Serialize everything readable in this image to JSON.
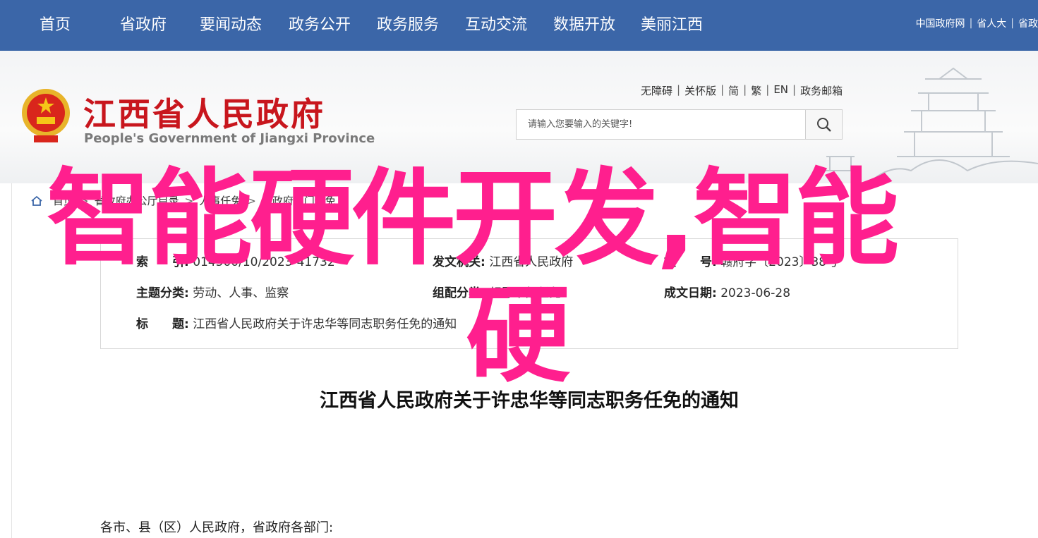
{
  "nav": {
    "items": [
      {
        "label": "首页"
      },
      {
        "label": "省政府"
      },
      {
        "label": "要闻动态"
      },
      {
        "label": "政务公开"
      },
      {
        "label": "政务服务"
      },
      {
        "label": "互动交流"
      },
      {
        "label": "数据开放"
      },
      {
        "label": "美丽江西"
      }
    ],
    "top_links": [
      "中国政府网",
      "省人大",
      "省政"
    ]
  },
  "header": {
    "title_cn": "江西省人民政府",
    "title_en": "People's Government of Jiangxi Province",
    "util_links": [
      "无障碍",
      "关怀版",
      "简",
      "繁",
      "EN",
      "政务邮箱"
    ],
    "search_placeholder": "请输入您要输入的关键字!"
  },
  "breadcrumb": [
    "首页",
    "省政府办公厅目录",
    "人事任免",
    "省政府部门任免"
  ],
  "meta": {
    "index_label": "索　　引",
    "index_value": "014500/10/2023-41732",
    "issuer_label": "发文机关",
    "issuer_value": "江西省人民政府",
    "docno_label": "文　　号",
    "docno_value": "赣府字〔2023〕38号",
    "topic_label": "主题分类",
    "topic_value": "劳动、人事、监察",
    "genre_label": "组配分类",
    "genre_value": "领导干部任免",
    "date_label": "成文日期",
    "date_value": "2023-06-28",
    "title_label": "标　　题",
    "title_value": "江西省人民政府关于许忠华等同志职务任免的通知"
  },
  "document": {
    "title": "江西省人民政府关于许忠华等同志职务任免的通知",
    "salutation": "各市、县（区）人民政府，省政府各部门:"
  },
  "overlay": {
    "line1": "智能硬件开发,智能",
    "line2": "硬"
  },
  "colors": {
    "nav_bg": "#3b66a8",
    "title_red": "#c8161d",
    "overlay_pink": "#ff1f8e"
  }
}
